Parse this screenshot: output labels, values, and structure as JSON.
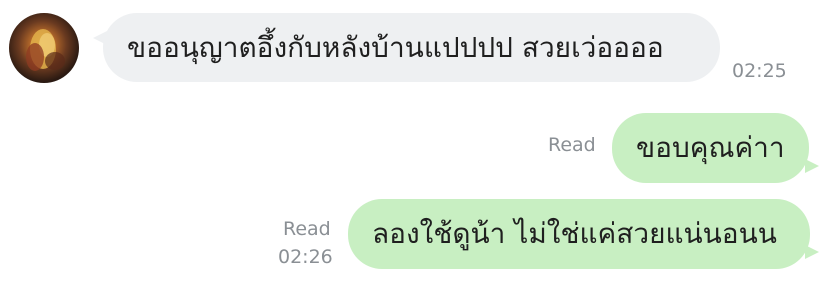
{
  "messages": [
    {
      "direction": "incoming",
      "text": "ขออนุญาตอึ้งกับหลังบ้านแปปปป สวยเว่ออออ",
      "time": "02:25"
    },
    {
      "direction": "outgoing",
      "text": "ขอบคุณค่าา",
      "status": "Read"
    },
    {
      "direction": "outgoing",
      "text": "ลองใช้ดูน้า ไม่ใช่แค่สวยแน่นอนน",
      "status": "Read",
      "time": "02:26"
    }
  ],
  "colors": {
    "incoming_bubble": "#eef0f2",
    "outgoing_bubble": "#c8efc2",
    "meta_text": "#8a8f94"
  }
}
